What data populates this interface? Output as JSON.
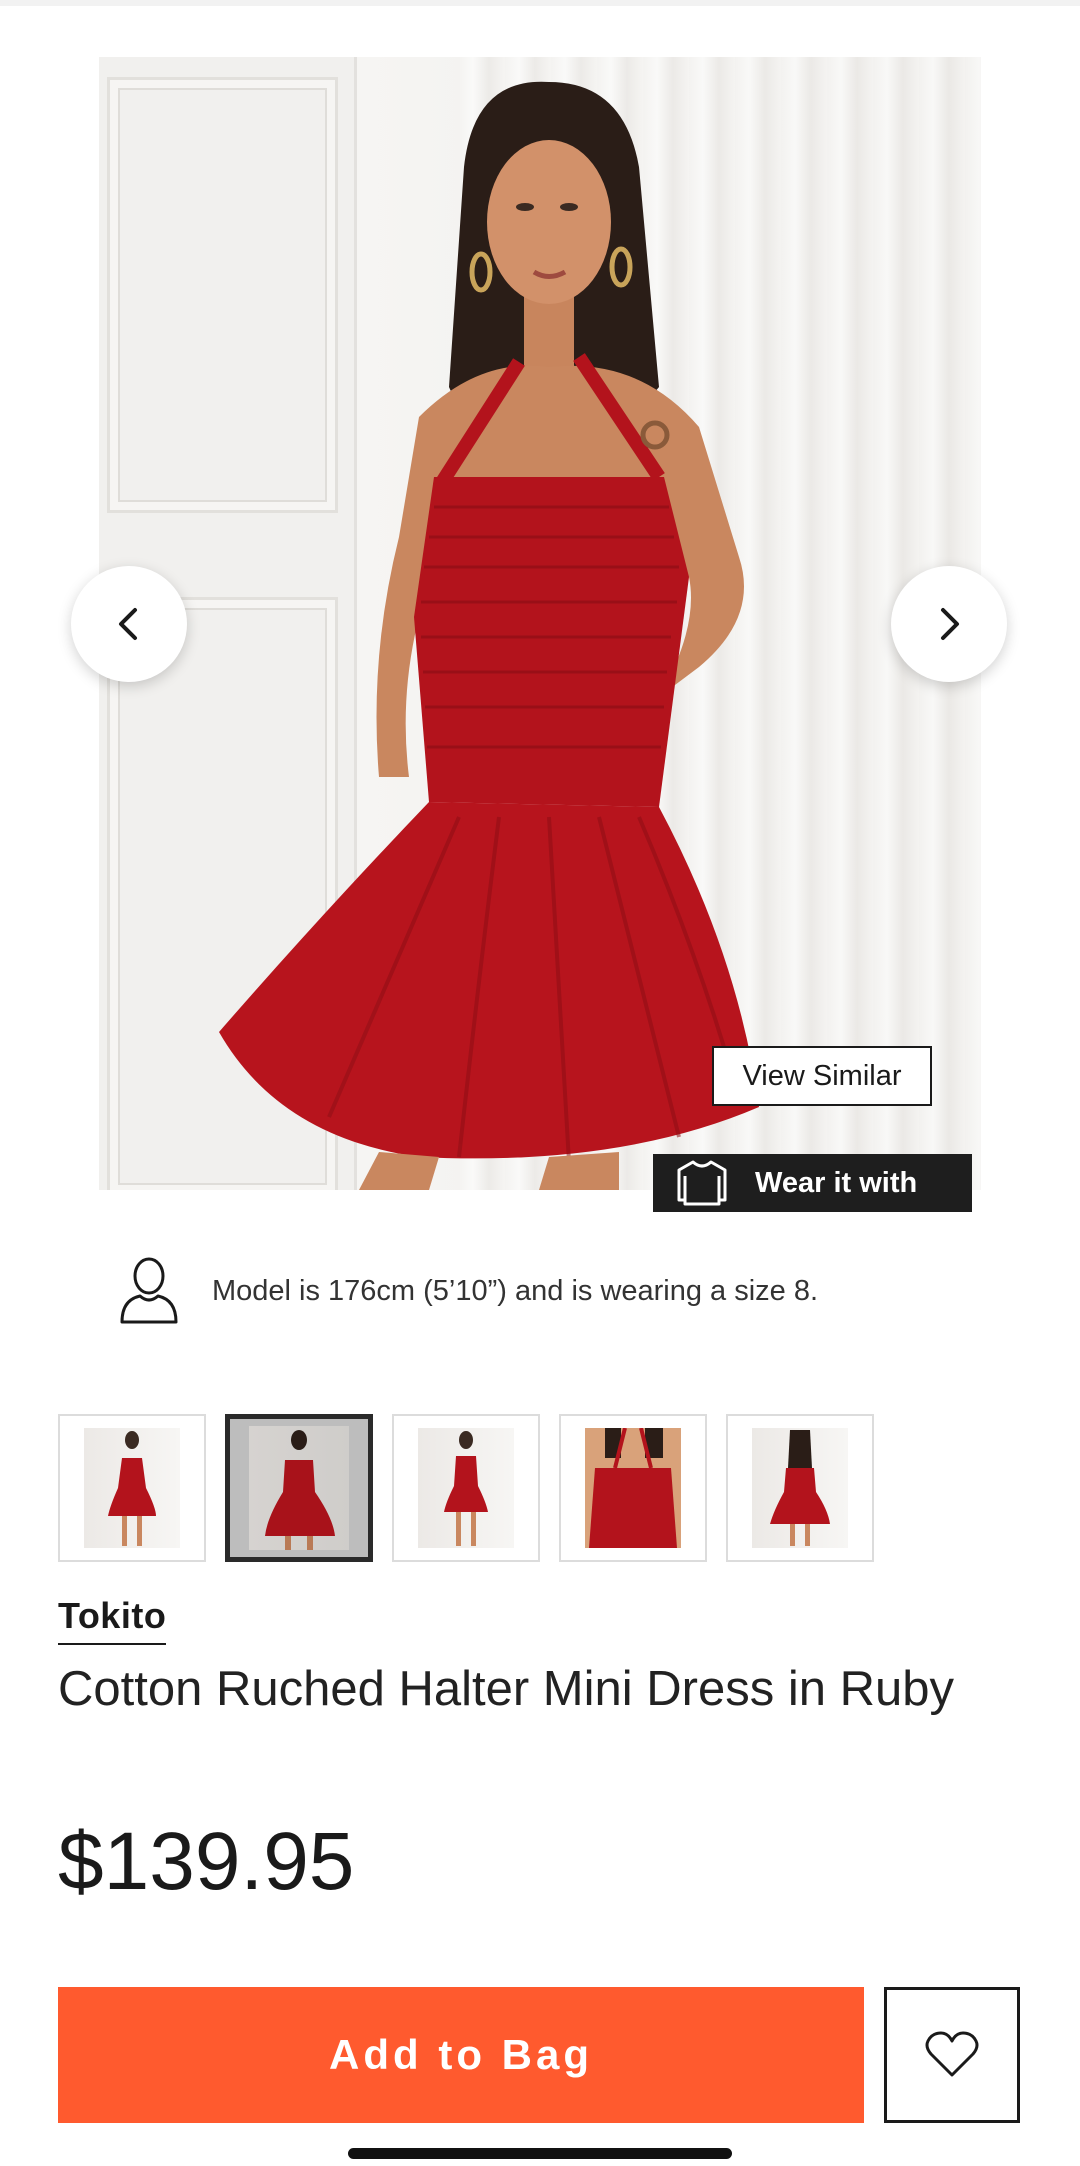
{
  "product": {
    "brand": "Tokito",
    "title": "Cotton Ruched Halter Mini Dress in Ruby",
    "price": "$139.95",
    "model_info": "Model is 176cm (5’10”) and is wearing a size 8."
  },
  "gallery": {
    "view_similar_label": "View Similar",
    "wear_it_with_label": "Wear it with",
    "selected_thumbnail_index": 1,
    "thumbnail_count": 5,
    "prev_icon": "chevron-left-icon",
    "next_icon": "chevron-right-icon"
  },
  "actions": {
    "add_to_bag_label": "Add to Bag",
    "wishlist_icon": "heart-icon"
  },
  "colors": {
    "accent": "#ff5a2e",
    "dress": "#b3131c",
    "dark": "#1e1e1e"
  }
}
